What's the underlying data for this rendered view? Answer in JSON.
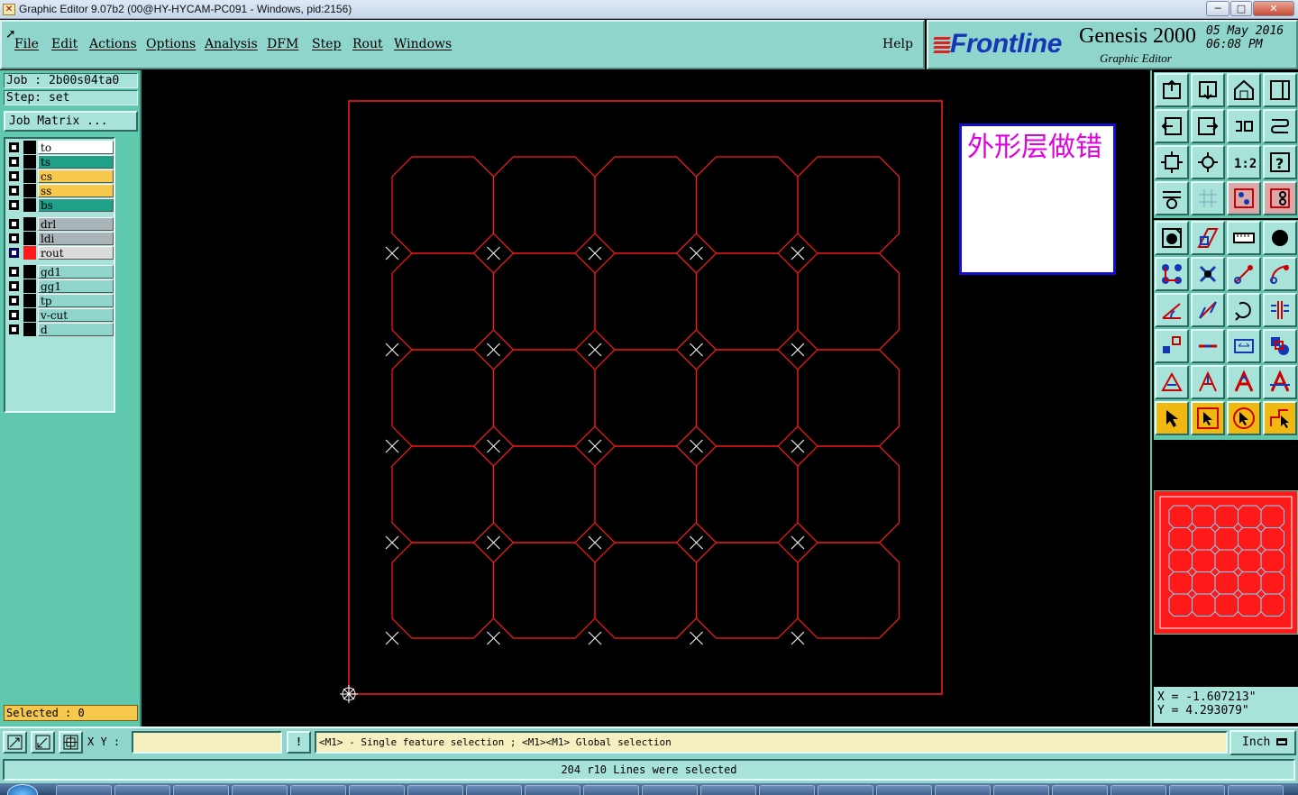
{
  "window": {
    "title": "Graphic Editor 9.07b2 (00@HY-HYCAM-PC091 - Windows, pid:2156)",
    "min_glyph": "─",
    "max_glyph": "□",
    "close_glyph": "✕"
  },
  "menu": {
    "items": [
      "File",
      "Edit",
      "Actions",
      "Options",
      "Analysis",
      "DFM",
      "Step",
      "Rout",
      "Windows"
    ],
    "help": "Help"
  },
  "logo": {
    "brand": "Frontline",
    "product": "Genesis 2000",
    "subtitle": "Graphic Editor",
    "date": "05 May 2016",
    "time": "06:08 PM"
  },
  "job": {
    "job_line": "Job : 2b00s04ta0",
    "step_line": "Step: set",
    "matrix_button": "Job Matrix ..."
  },
  "layers": [
    {
      "name": "to",
      "color": "#ffffff",
      "swatch": "#000000"
    },
    {
      "name": "ts",
      "color": "#1ea089",
      "swatch": "#000000"
    },
    {
      "name": "cs",
      "color": "#f6c94d",
      "swatch": "#000000"
    },
    {
      "name": "ss",
      "color": "#f6c94d",
      "swatch": "#000000"
    },
    {
      "name": "bs",
      "color": "#1ea089",
      "swatch": "#000000"
    },
    {
      "name": "drl",
      "color": "#a8b4b8",
      "swatch": "#000000"
    },
    {
      "name": "ldi",
      "color": "#a8b4b8",
      "swatch": "#000000"
    },
    {
      "name": "rout",
      "color": "#dcdcdc",
      "swatch": "#ff1a1a",
      "active": true
    },
    {
      "name": "gd1",
      "color": "#8fd5cb",
      "swatch": "#000000"
    },
    {
      "name": "gg1",
      "color": "#8fd5cb",
      "swatch": "#000000"
    },
    {
      "name": "tp",
      "color": "#8fd5cb",
      "swatch": "#000000"
    },
    {
      "name": "v-cut",
      "color": "#8fd5cb",
      "swatch": "#000000"
    },
    {
      "name": "d",
      "color": "#8fd5cb",
      "swatch": "#000000"
    }
  ],
  "selected": "Selected : 0",
  "note": "外形层做错",
  "tools": [
    "load-top-icon",
    "load-bottom-icon",
    "home-icon",
    "window-icon",
    "pan-left-icon",
    "pan-right-icon",
    "undo-view-icon",
    "redo-view-icon",
    "fit-icon",
    "zoom-fit-icon",
    "scale-1-2-icon",
    "help-icon",
    "layer-props-icon",
    "grid-icon",
    "snap-icon",
    "snap-off-icon",
    "pad-icon",
    "shape-icon",
    "ruler-icon",
    "circle-icon",
    "nodes-icon",
    "cross-icon",
    "line-icon",
    "arc-icon",
    "slope-icon",
    "diagonal-icon",
    "rotate-icon",
    "mirror-icon",
    "move-icon",
    "edge-icon",
    "measure-icon",
    "connect-icon",
    "triangle-icon",
    "text-a-icon",
    "text-a2-icon",
    "text-a3-icon",
    "pointer-icon",
    "pointer-box-icon",
    "pointer-circle-icon",
    "pointer-path-icon"
  ],
  "coords": {
    "x": "X = -1.607213\"",
    "y": "Y = 4.293079\""
  },
  "command": {
    "xy_label": "X Y :",
    "xy_value": "",
    "alert_glyph": "!",
    "message": "<M1> - Single feature selection ; <M1><M1> Global selection",
    "units": "Inch"
  },
  "status": "204 r10 Lines were selected",
  "colors": {
    "rout": "#ff1a1a",
    "panel": "#8fd5cb",
    "note_text": "#e000e0",
    "note_border": "#1010c8"
  }
}
